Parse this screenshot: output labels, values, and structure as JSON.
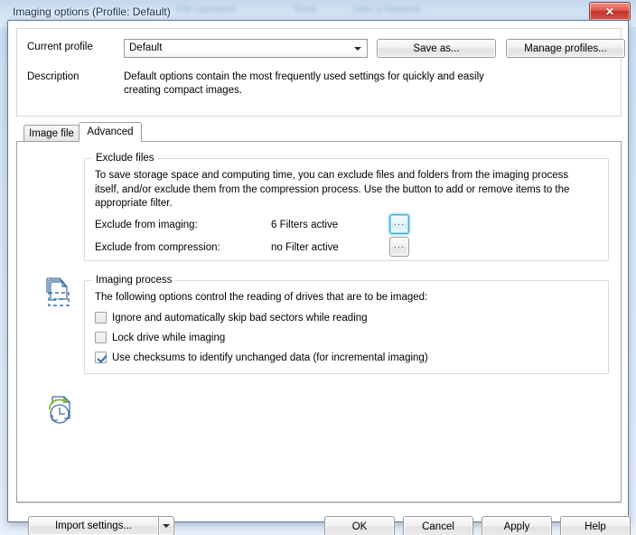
{
  "window": {
    "title": "Imaging options (Profile: Default)",
    "close_label": "✕",
    "ghosts": [
      "File operation",
      "Tools",
      "Jobs & Reports"
    ]
  },
  "profile": {
    "current_profile_label": "Current profile",
    "current_profile_value": "Default",
    "description_label": "Description",
    "description_text": "Default options contain the most frequently used settings for quickly and easily creating compact images.",
    "save_as_label": "Save as...",
    "manage_profiles_label": "Manage profiles..."
  },
  "tabs": [
    {
      "label": "Image file",
      "active": false
    },
    {
      "label": "Advanced",
      "active": true
    }
  ],
  "exclude_files": {
    "legend": "Exclude files",
    "paragraph": "To save storage space and computing time, you can exclude files and folders from the imaging process itself, and/or exclude them from the compression process. Use the button to add or remove items to the appropriate filter.",
    "rows": [
      {
        "label": "Exclude from imaging:",
        "value": "6 Filters active",
        "button_label": "...",
        "focused": true
      },
      {
        "label": "Exclude from compression:",
        "value": "no Filter active",
        "button_label": "...",
        "focused": false
      }
    ],
    "icon": "documents-exclude-icon"
  },
  "imaging_process": {
    "legend": "Imaging process",
    "paragraph": "The following options control the reading of drives that are to be imaged:",
    "checkboxes": [
      {
        "label": "Ignore and automatically skip bad sectors while reading",
        "checked": false
      },
      {
        "label": "Lock drive while imaging",
        "checked": false
      },
      {
        "label": "Use checksums to identify unchanged data (for incremental imaging)",
        "checked": true
      }
    ],
    "icon": "document-clock-icon"
  },
  "footer": {
    "import_settings_label": "Import settings...",
    "ok_label": "OK",
    "cancel_label": "Cancel",
    "apply_label": "Apply",
    "help_label": "Help"
  },
  "colors": {
    "accent_blue": "#3ea8d6",
    "icon_blue": "#3a6ea5",
    "icon_green": "#7ab929",
    "close_red": "#c4332a",
    "title_text": "#16314d"
  }
}
